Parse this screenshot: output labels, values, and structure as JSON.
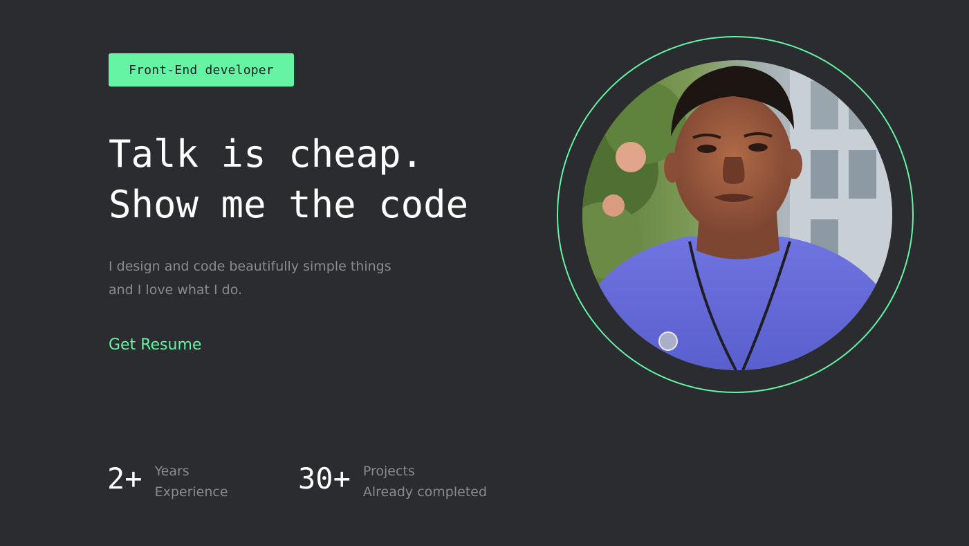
{
  "hero": {
    "role_badge": "Front-End developer",
    "headline_line1": "Talk is cheap.",
    "headline_line2": "Show me the code",
    "intro_line1": "I design and code beautifully simple things",
    "intro_line2": "and I love what I do.",
    "resume_link": "Get Resume"
  },
  "stats": [
    {
      "number": "2+",
      "caption_line1": "Years",
      "caption_line2": "Experience"
    },
    {
      "number": "30+",
      "caption_line1": "Projects",
      "caption_line2": "Already completed"
    }
  ],
  "colors": {
    "background": "#2b2c30",
    "accent": "#64f4a4",
    "text_primary": "#ffffff",
    "text_muted": "#8a8b8f"
  }
}
